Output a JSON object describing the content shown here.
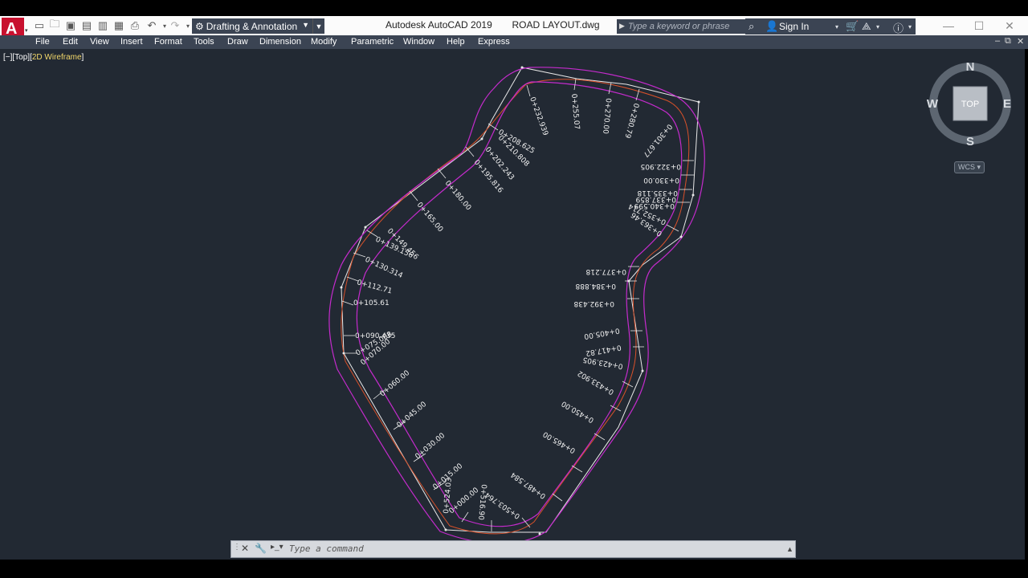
{
  "app": {
    "title": "Autodesk AutoCAD 2019",
    "file": "ROAD LAYOUT.dwg",
    "workspace": "Drafting & Annotation",
    "search_placeholder": "Type a keyword or phrase",
    "sign_in": "Sign In"
  },
  "menu": [
    "File",
    "Edit",
    "View",
    "Insert",
    "Format",
    "Tools",
    "Draw",
    "Dimension",
    "Modify",
    "Parametric",
    "Window",
    "Help",
    "Express"
  ],
  "viewport": {
    "bracket_open": "[−][Top][",
    "visual_style": "2D Wireframe",
    "bracket_close": "]"
  },
  "viewcube": {
    "n": "N",
    "s": "S",
    "e": "E",
    "w": "W",
    "face": "TOP",
    "wcs": "WCS ▾"
  },
  "command": {
    "placeholder": "Type a command"
  },
  "colors": {
    "canvas": "#222933",
    "edge": "#ffffff",
    "centerline": "#d8512a",
    "offset": "#c42bcc",
    "accent": "#3b4453"
  },
  "stations": [
    "0+000.00",
    "0+015.00",
    "0+030.00",
    "0+045.00",
    "0+060.00",
    "0+070.00",
    "0+075.008",
    "0+090.435",
    "0+105.61",
    "0+112.71",
    "0+130.314",
    "0+139.156",
    "0+149.456",
    "0+165.00",
    "0+180.00",
    "0+195.816",
    "0+202.243",
    "0+208.625",
    "0+210.808",
    "0+232.939",
    "0+255.07",
    "0+270.00",
    "0+280.79",
    "0+301.677",
    "0+322.905",
    "0+330.00",
    "0+335.118",
    "0+337.859",
    "0+340.599",
    "0+352.714",
    "0+363.46",
    "0+377.218",
    "0+384.888",
    "0+392.438",
    "0+405.00",
    "0+417.82",
    "0+423.905",
    "0+433.902",
    "0+450.00",
    "0+465.00",
    "0+487.584",
    "0+503.764",
    "0+516.90",
    "0+524.03"
  ]
}
